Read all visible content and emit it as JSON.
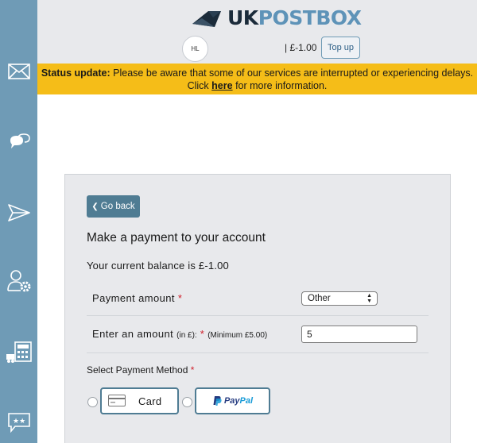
{
  "sidebar": {
    "items": [
      {
        "name": "mail-icon"
      },
      {
        "name": "chat-bubbles-icon"
      },
      {
        "name": "send-icon"
      },
      {
        "name": "user-settings-icon"
      },
      {
        "name": "calculator-truck-icon"
      },
      {
        "name": "reviews-star-icon"
      }
    ]
  },
  "header": {
    "logo_uk": "UK",
    "logo_postbox": "POSTBOX",
    "avatar_initials": "HL",
    "balance": "| £-1.00",
    "topup_label": "Top up"
  },
  "status": {
    "label": "Status update:",
    "message": "Please be aware that some of our services are interrupted or experiencing delays. Click",
    "link": "here",
    "message_end": "for more information."
  },
  "payment": {
    "back_label": "Go back",
    "title": "Make a payment to your account",
    "current_balance": "Your current balance is £-1.00",
    "amount_label": "Payment amount",
    "amount_select_value": "Other",
    "enter_label": "Enter an amount",
    "enter_unit": "(in £):",
    "enter_min": "(Minimum £5.00)",
    "enter_value": "5",
    "required_mark": "*",
    "method_label": "Select Payment Method",
    "card_label": "Card",
    "paypal_part1": "Pay",
    "paypal_part2": "Pal"
  },
  "colors": {
    "sidebar": "#6f9bb6",
    "status_bar": "#f5bd18",
    "button": "#4f7c93",
    "logo_dark": "#1b2b3a",
    "logo_light": "#5e93b8"
  }
}
